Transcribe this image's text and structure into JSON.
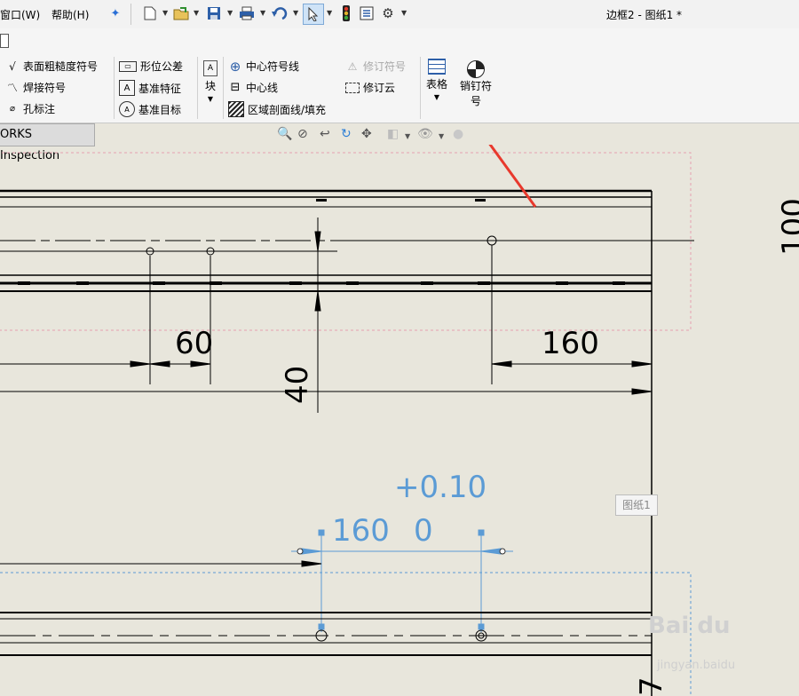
{
  "menu": {
    "window": "窗口(W)",
    "help": "帮助(H)"
  },
  "window_title": "边框2 - 图纸1 *",
  "annotation_toolbar": {
    "surface_finish": "表面粗糙度符号",
    "weld_symbol": "焊接符号",
    "hole_callout": "孔标注",
    "gtol": "形位公差",
    "datum_feature": "基准特征",
    "datum_target": "基准目标",
    "block": "块",
    "center_mark": "中心符号线",
    "centerline": "中心线",
    "area_hatch": "区域剖面线/填充",
    "revision_symbol": "修订符号",
    "revision_cloud": "修订云",
    "table": "表格",
    "dowel_pin_line1": "销钉符",
    "dowel_pin_line2": "号"
  },
  "tab_label": "ORKS Inspection",
  "drawing": {
    "dim_60": "60",
    "dim_160": "160",
    "dim_40": "40",
    "dim_100_partial": "100",
    "dim_7_partial": "7",
    "tol_upper": "+0.10",
    "tol_nominal": "160",
    "tol_lower": "0"
  },
  "sheet_label": "图纸1",
  "watermark": "Bai du",
  "watermark_sub": "jingyan.baidu",
  "colors": {
    "annotation_blue": "#5b9bd5",
    "arrow_red": "#e8392d",
    "border_pink": "#e6a0b0"
  }
}
